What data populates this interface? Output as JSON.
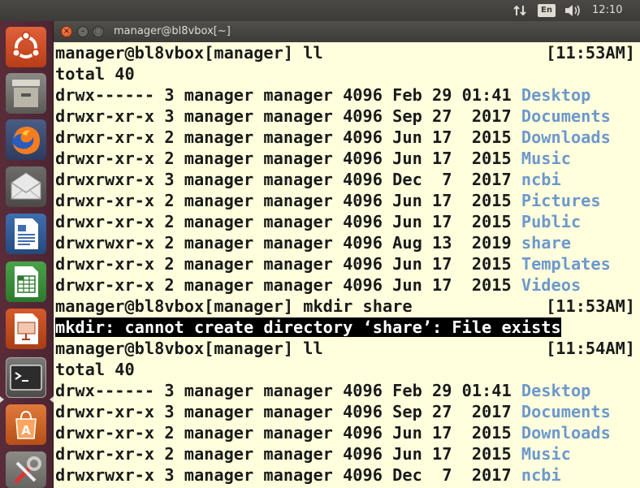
{
  "top_panel": {
    "network_icon": "network-updown-icon",
    "keyboard_layout": "En",
    "volume_icon": "volume-icon",
    "clock": "12:10"
  },
  "launcher": {
    "items": [
      {
        "name": "ubuntu-dash",
        "icon": "ubuntu-logo-icon",
        "running": false
      },
      {
        "name": "files",
        "icon": "file-cabinet-icon",
        "running": false
      },
      {
        "name": "firefox",
        "icon": "firefox-icon",
        "running": false
      },
      {
        "name": "thunderbird",
        "icon": "mail-envelope-icon",
        "running": false
      },
      {
        "name": "writer",
        "icon": "document-writer-icon",
        "running": false
      },
      {
        "name": "calc",
        "icon": "spreadsheet-calc-icon",
        "running": false
      },
      {
        "name": "impress",
        "icon": "presentation-impress-icon",
        "running": false
      },
      {
        "name": "terminal",
        "icon": "terminal-icon",
        "running": true
      },
      {
        "name": "software",
        "icon": "software-center-icon",
        "running": false
      },
      {
        "name": "settings",
        "icon": "system-settings-icon",
        "running": false
      }
    ],
    "terminal_glyph": ">_"
  },
  "window": {
    "title": "manager@bl8vbox[~]",
    "close_glyph": "×",
    "min_glyph": "–",
    "max_glyph": "□"
  },
  "terminal": {
    "lines": [
      {
        "kind": "prompt",
        "text": "manager@bl8vbox[manager] ll",
        "time": "[11:53AM]"
      },
      {
        "kind": "plain",
        "text": "total 40"
      },
      {
        "kind": "ls",
        "text": "drwx------ 3 manager manager 4096 Feb 29 01:41 ",
        "name": "Desktop"
      },
      {
        "kind": "ls",
        "text": "drwxr-xr-x 3 manager manager 4096 Sep 27  2017 ",
        "name": "Documents"
      },
      {
        "kind": "ls",
        "text": "drwxr-xr-x 2 manager manager 4096 Jun 17  2015 ",
        "name": "Downloads"
      },
      {
        "kind": "ls",
        "text": "drwxr-xr-x 2 manager manager 4096 Jun 17  2015 ",
        "name": "Music"
      },
      {
        "kind": "ls",
        "text": "drwxrwxr-x 3 manager manager 4096 Dec  7  2017 ",
        "name": "ncbi"
      },
      {
        "kind": "ls",
        "text": "drwxr-xr-x 2 manager manager 4096 Jun 17  2015 ",
        "name": "Pictures"
      },
      {
        "kind": "ls",
        "text": "drwxr-xr-x 2 manager manager 4096 Jun 17  2015 ",
        "name": "Public"
      },
      {
        "kind": "ls",
        "text": "drwxrwxr-x 2 manager manager 4096 Aug 13  2019 ",
        "name": "share"
      },
      {
        "kind": "ls",
        "text": "drwxr-xr-x 2 manager manager 4096 Jun 17  2015 ",
        "name": "Templates"
      },
      {
        "kind": "ls",
        "text": "drwxr-xr-x 2 manager manager 4096 Jun 17  2015 ",
        "name": "Videos"
      },
      {
        "kind": "prompt",
        "text": "manager@bl8vbox[manager] mkdir share",
        "time": "[11:53AM]"
      },
      {
        "kind": "error",
        "text": "mkdir: cannot create directory ‘share’: File exists"
      },
      {
        "kind": "prompt",
        "text": "manager@bl8vbox[manager] ll",
        "time": "[11:54AM]"
      },
      {
        "kind": "plain",
        "text": "total 40"
      },
      {
        "kind": "ls",
        "text": "drwx------ 3 manager manager 4096 Feb 29 01:41 ",
        "name": "Desktop"
      },
      {
        "kind": "ls",
        "text": "drwxr-xr-x 3 manager manager 4096 Sep 27  2017 ",
        "name": "Documents"
      },
      {
        "kind": "ls",
        "text": "drwxr-xr-x 2 manager manager 4096 Jun 17  2015 ",
        "name": "Downloads"
      },
      {
        "kind": "ls",
        "text": "drwxr-xr-x 2 manager manager 4096 Jun 17  2015 ",
        "name": "Music"
      },
      {
        "kind": "ls",
        "text": "drwxrwxr-x 3 manager manager 4096 Dec  7  2017 ",
        "name": "ncbi"
      }
    ]
  },
  "colors": {
    "terminal_bg": "#ffffdd",
    "terminal_fg": "#1a1a1a",
    "directory": "#6d98cd",
    "launcher_bg": "#5a2c3a",
    "close_button": "#df4a16"
  }
}
